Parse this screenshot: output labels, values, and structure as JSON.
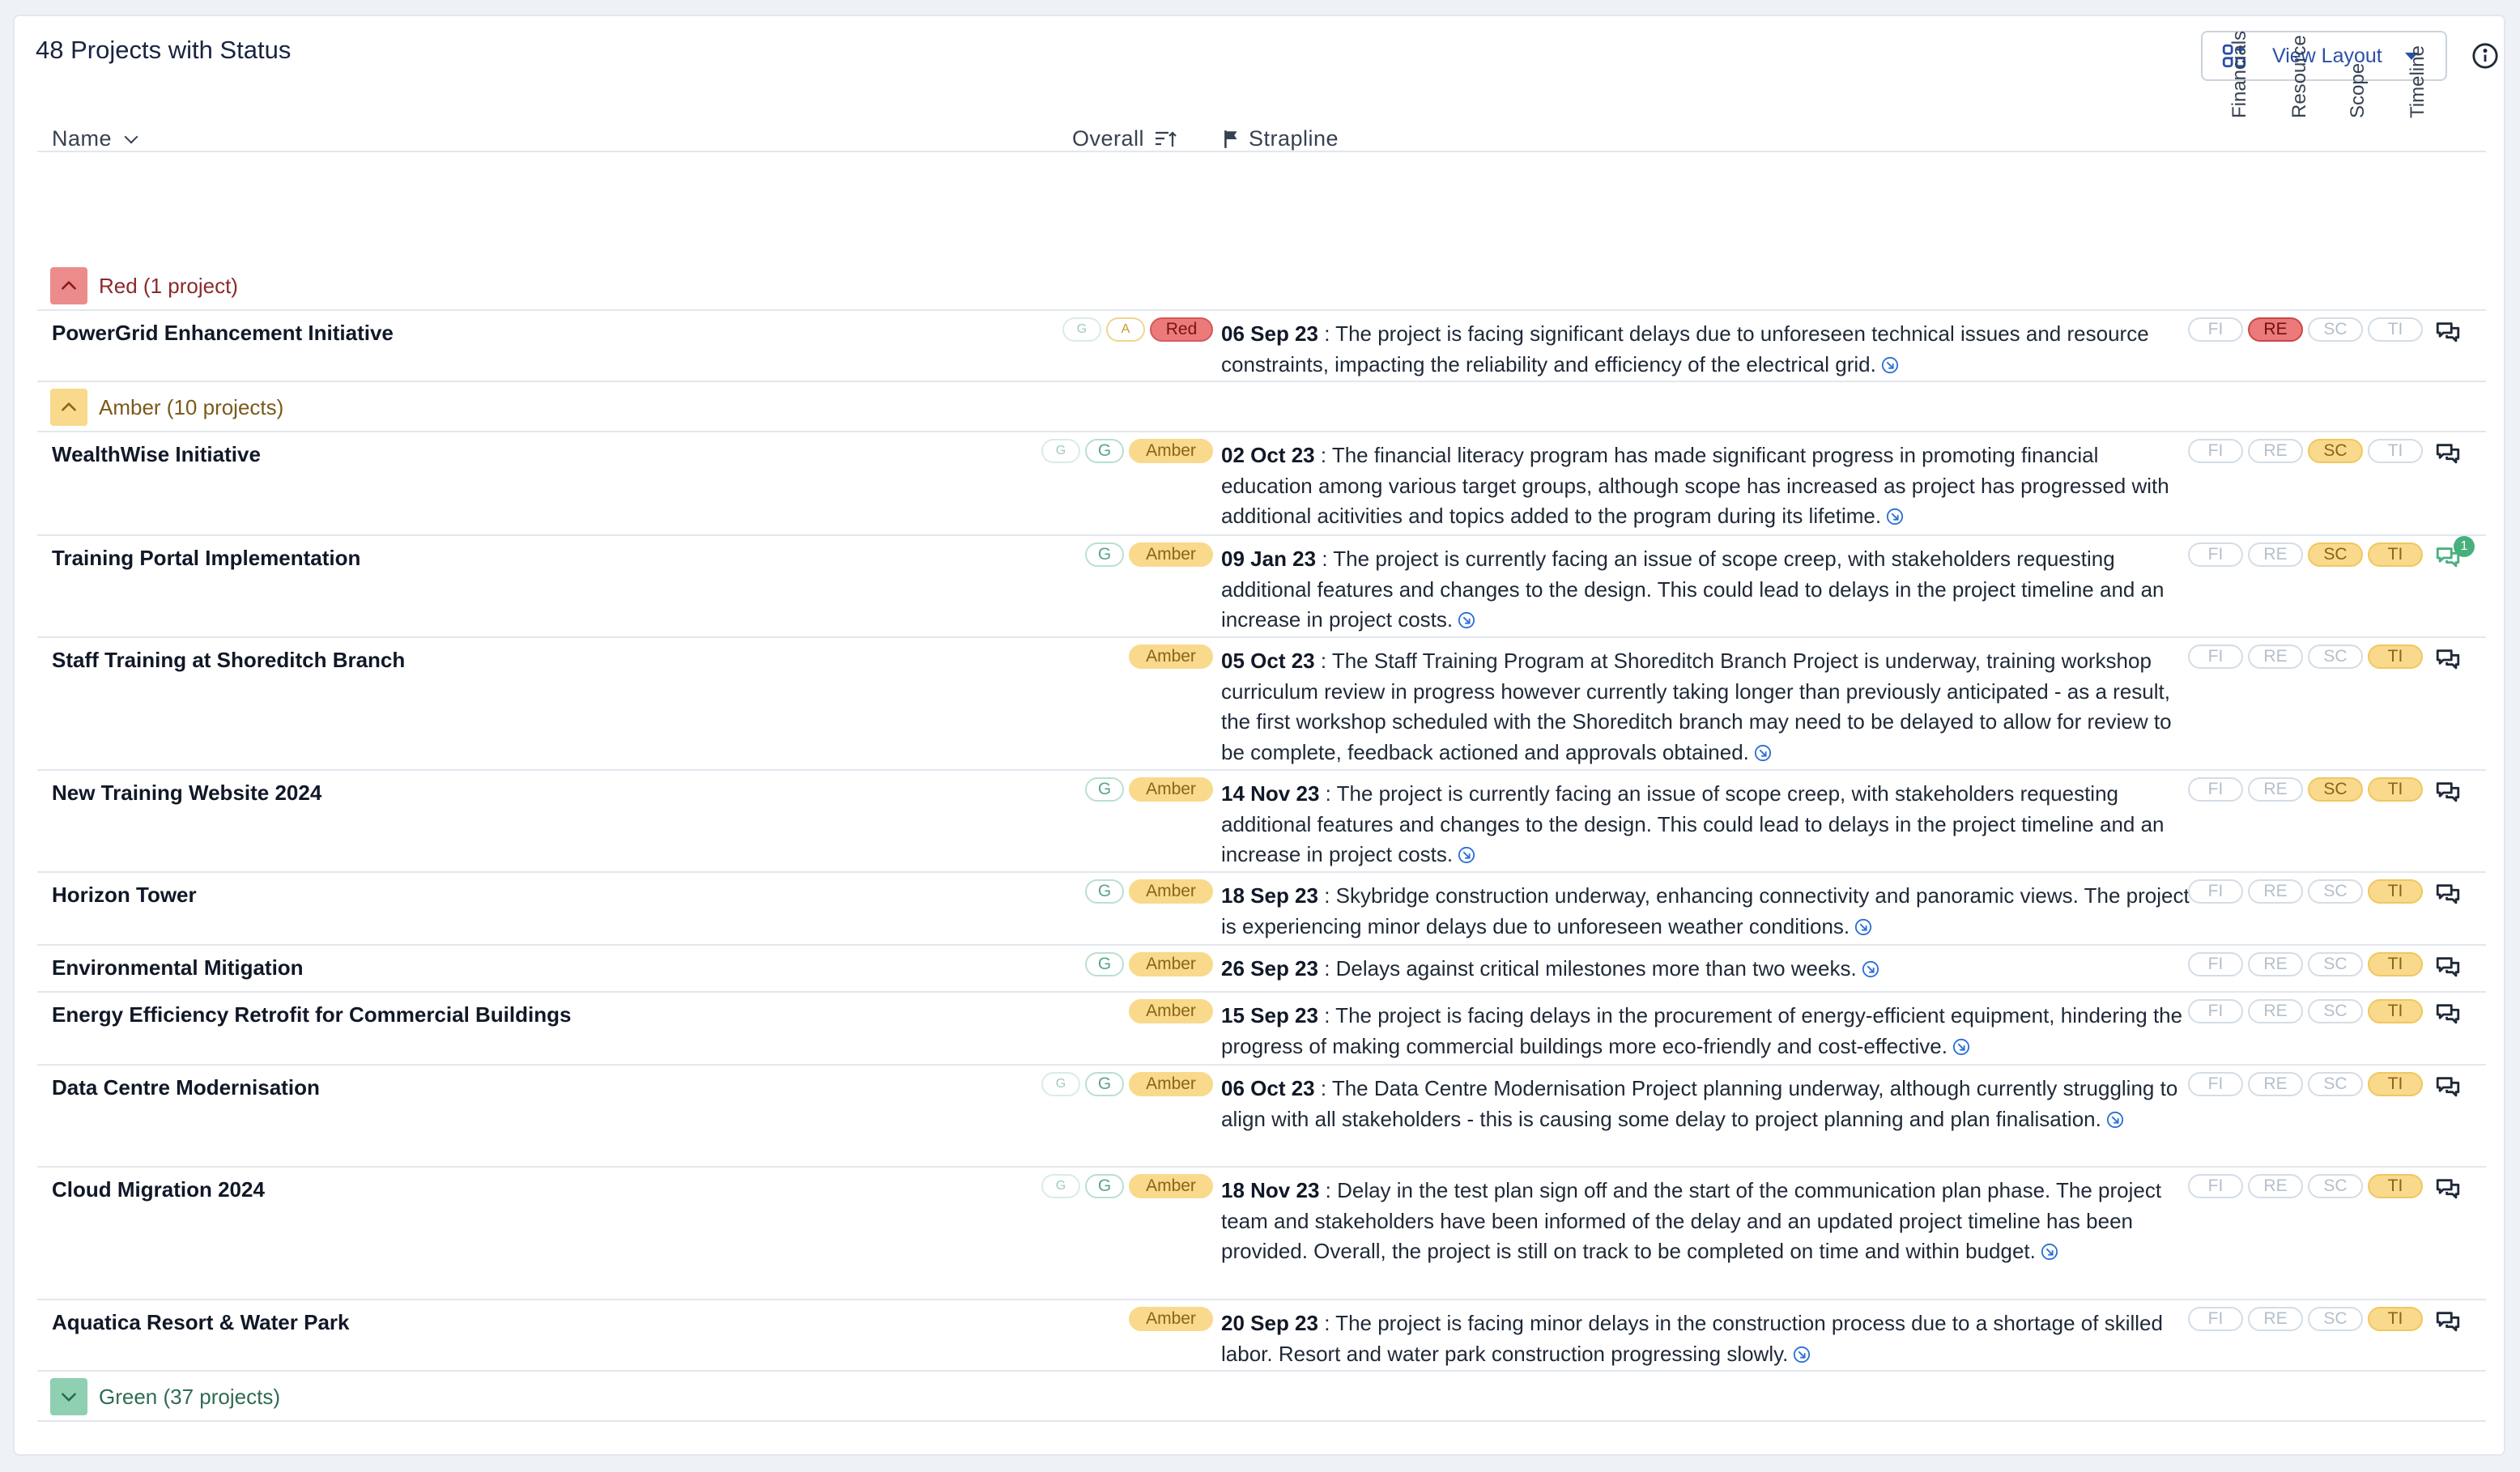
{
  "header": {
    "title": "48 Projects with Status",
    "view_layout_label": "View Layout"
  },
  "columns": {
    "name": "Name",
    "overall": "Overall",
    "strapline": "Strapline",
    "indicators": [
      "Financials",
      "Resource",
      "Scope",
      "Timeline"
    ]
  },
  "groups": {
    "red": {
      "label": "Red (1 project)"
    },
    "amber": {
      "label": "Amber (10 projects)"
    },
    "green": {
      "label": "Green (37 projects)"
    }
  },
  "indicator_labels": [
    "FI",
    "RE",
    "SC",
    "TI"
  ],
  "colors": {
    "red": "#ec7a7a",
    "amber": "#f9d98c",
    "green": "#8fcfb2",
    "link": "#2b6fd6"
  },
  "rows": [
    {
      "name": "PowerGrid Enhancement Initiative",
      "history": [
        "G",
        "A"
      ],
      "overall": "Red",
      "date": "06 Sep 23",
      "text": " : The project is facing significant delays due to unforeseen technical issues and resource constraints, impacting the reliability and efficiency of the electrical grid.",
      "indicators": [
        "",
        "red",
        "",
        ""
      ],
      "comments": ""
    },
    {
      "name": "WealthWise Initiative",
      "history": [
        "G",
        "G"
      ],
      "overall": "Amber",
      "date": "02 Oct 23",
      "text": " : The financial literacy program has made significant progress in promoting financial education among various target groups, although scope has increased as project has progressed with additional acitivities and topics added to the program during its lifetime.",
      "indicators": [
        "",
        "",
        "amber",
        ""
      ],
      "comments": ""
    },
    {
      "name": "Training Portal Implementation",
      "history": [
        "G"
      ],
      "overall": "Amber",
      "date": "09 Jan 23",
      "text": " : The project is currently facing an issue of scope creep, with stakeholders requesting additional features and changes to the design. This could lead to delays in the project timeline and an increase in project costs.",
      "indicators": [
        "",
        "",
        "amber",
        "amber"
      ],
      "comments": "1"
    },
    {
      "name": "Staff Training at Shoreditch Branch",
      "history": [],
      "overall": "Amber",
      "date": "05 Oct 23",
      "text": " : The Staff Training Program at Shoreditch Branch Project is underway, training workshop curriculum review in progress however currently taking longer than previously anticipated - as a result, the first workshop scheduled with the Shoreditch branch may need to be delayed to allow for review to be complete, feedback actioned and approvals obtained.",
      "indicators": [
        "",
        "",
        "",
        "amber"
      ],
      "comments": ""
    },
    {
      "name": "New Training Website 2024",
      "history": [
        "G"
      ],
      "overall": "Amber",
      "date": "14 Nov 23",
      "text": " : The project is currently facing an issue of scope creep, with stakeholders requesting additional features and changes to the design. This could lead to delays in the project timeline and an increase in project costs.",
      "indicators": [
        "",
        "",
        "amber",
        "amber"
      ],
      "comments": ""
    },
    {
      "name": "Horizon Tower",
      "history": [
        "G"
      ],
      "overall": "Amber",
      "date": "18 Sep 23",
      "text": " : Skybridge construction underway, enhancing connectivity and panoramic views. The project is experiencing minor delays due to unforeseen weather conditions.",
      "indicators": [
        "",
        "",
        "",
        "amber"
      ],
      "comments": ""
    },
    {
      "name": "Environmental Mitigation",
      "history": [
        "G"
      ],
      "overall": "Amber",
      "date": "26 Sep 23",
      "text": " : Delays against critical milestones more than two weeks.",
      "indicators": [
        "",
        "",
        "",
        "amber"
      ],
      "comments": ""
    },
    {
      "name": "Energy Efficiency Retrofit for Commercial Buildings",
      "history": [],
      "overall": "Amber",
      "date": "15 Sep 23",
      "text": " : The project is facing delays in the procurement of energy-efficient equipment, hindering the progress of making commercial buildings more eco-friendly and cost-effective.",
      "indicators": [
        "",
        "",
        "",
        "amber"
      ],
      "comments": ""
    },
    {
      "name": "Data Centre Modernisation",
      "history": [
        "G",
        "G"
      ],
      "overall": "Amber",
      "date": "06 Oct 23",
      "text": " : The Data Centre Modernisation Project planning underway, although currently struggling to align with all stakeholders - this is causing some delay to project planning and plan finalisation.",
      "indicators": [
        "",
        "",
        "",
        "amber"
      ],
      "comments": ""
    },
    {
      "name": "Cloud Migration 2024",
      "history": [
        "G",
        "G"
      ],
      "overall": "Amber",
      "date": "18 Nov 23",
      "text": " : Delay in the test plan sign off and the start of the communication plan phase. The project team and stakeholders have been informed of the delay and an updated project timeline has been provided. Overall, the project is still on track to be completed on time and within budget.",
      "indicators": [
        "",
        "",
        "",
        "amber"
      ],
      "comments": ""
    },
    {
      "name": "Aquatica Resort & Water Park",
      "history": [],
      "overall": "Amber",
      "date": "20 Sep 23",
      "text": " : The project is facing minor delays in the construction process due to a shortage of skilled labor. Resort and water park construction progressing slowly.",
      "indicators": [
        "",
        "",
        "",
        "amber"
      ],
      "comments": ""
    }
  ]
}
